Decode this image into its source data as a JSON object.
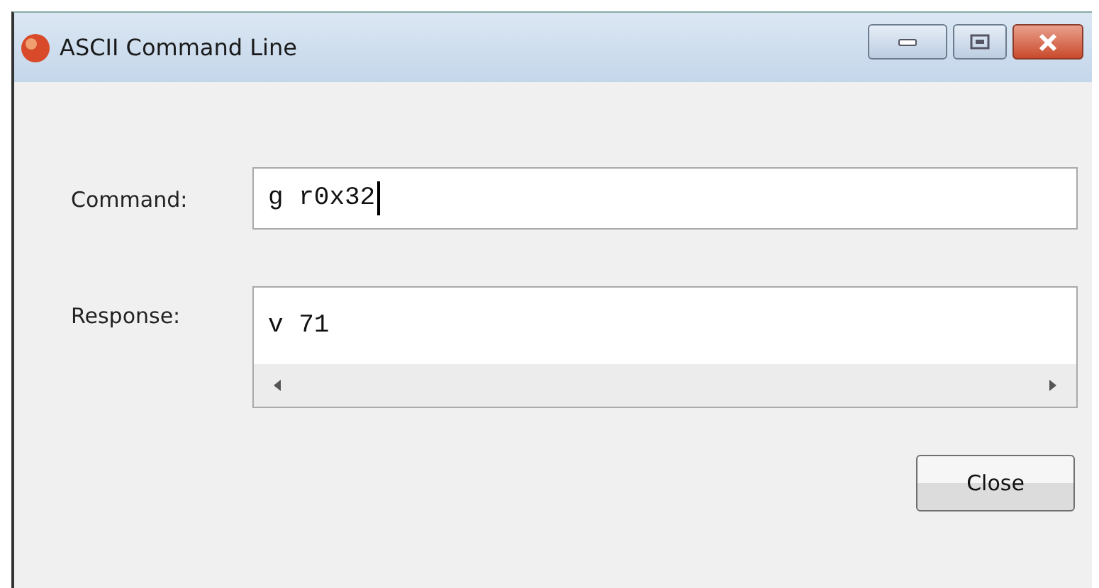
{
  "window": {
    "title": "ASCII Command Line"
  },
  "fields": [
    {
      "label": "Command:",
      "value": "g r0x32",
      "kind": "single",
      "focused": true
    },
    {
      "label": "Response:",
      "value": "v 71",
      "kind": "scroll",
      "focused": false
    }
  ],
  "buttons": [
    {
      "label": "Close"
    }
  ]
}
